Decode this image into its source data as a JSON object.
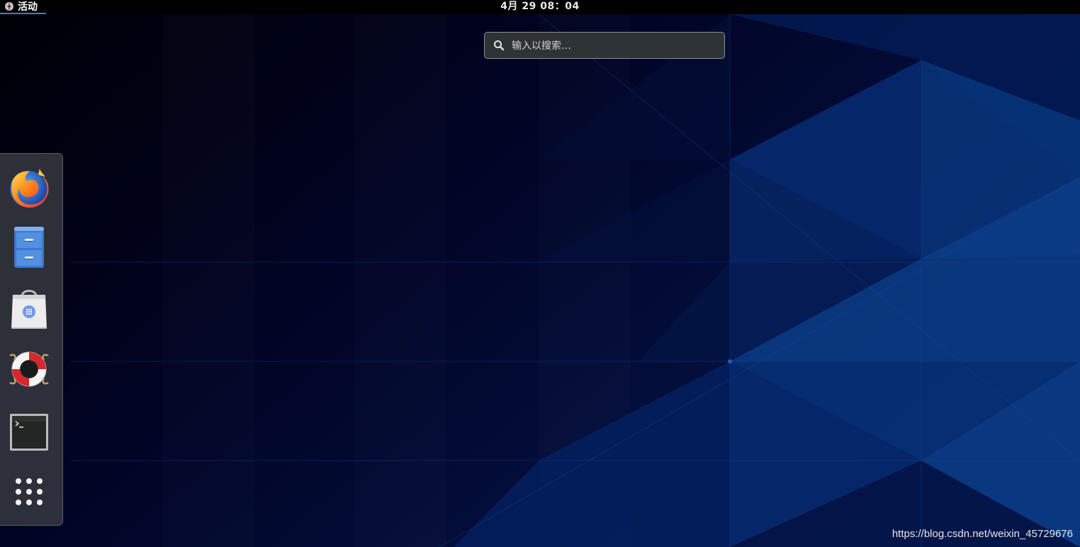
{
  "topbar": {
    "activities_label": "活动",
    "clock": "4月 29  08：04"
  },
  "search": {
    "placeholder": "输入以搜索…"
  },
  "dock": {
    "items": [
      {
        "name": "firefox",
        "icon": "firefox-icon"
      },
      {
        "name": "files",
        "icon": "file-cabinet-icon"
      },
      {
        "name": "software",
        "icon": "software-bag-icon"
      },
      {
        "name": "help",
        "icon": "lifebuoy-icon"
      },
      {
        "name": "terminal",
        "icon": "terminal-icon"
      },
      {
        "name": "show-applications",
        "icon": "app-grid-icon"
      }
    ]
  },
  "watermark": "https://blog.csdn.net/weixin_45729676",
  "colors": {
    "topbar_bg": "#000000",
    "accent": "#3b7fd4",
    "wallpaper_dark": "#020414",
    "wallpaper_blue": "#0b3a78"
  }
}
